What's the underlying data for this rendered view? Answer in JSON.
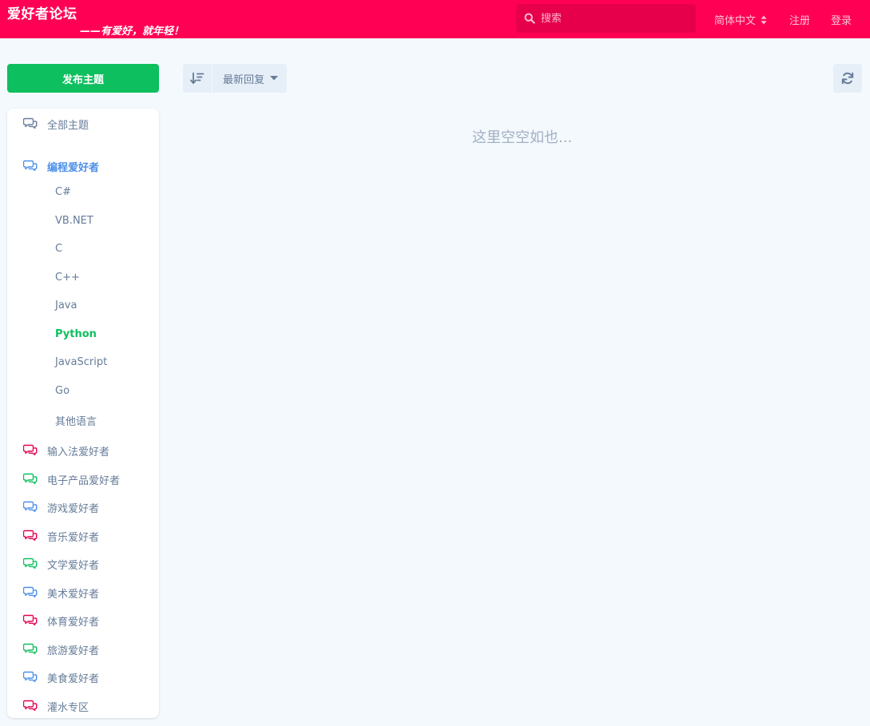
{
  "header": {
    "brand": "爱好者论坛",
    "slogan": "——有爱好，就年轻！",
    "search_placeholder": "搜索",
    "language": "简体中文",
    "register": "注册",
    "login": "登录"
  },
  "colors": {
    "brand_bar": "#ff0055",
    "primary_green": "#0dbf5e",
    "link_blue": "#4d8fe8",
    "muted_text": "#667c99"
  },
  "new_topic_label": "发布主题",
  "sidebar": {
    "all_topics": "全部主题",
    "programming": {
      "label": "编程爱好者",
      "children": [
        "C#",
        "VB.NET",
        "C",
        "C++",
        "Java",
        "Python",
        "JavaScript",
        "Go",
        "其他语言"
      ],
      "active_child": "Python"
    },
    "tags": [
      {
        "label": "输入法爱好者",
        "color": "#e6004c"
      },
      {
        "label": "电子产品爱好者",
        "color": "#0dbf5e"
      },
      {
        "label": "游戏爱好者",
        "color": "#4d8fe8"
      },
      {
        "label": "音乐爱好者",
        "color": "#e6004c"
      },
      {
        "label": "文学爱好者",
        "color": "#0dbf5e"
      },
      {
        "label": "美术爱好者",
        "color": "#4d8fe8"
      },
      {
        "label": "体育爱好者",
        "color": "#e6004c"
      },
      {
        "label": "旅游爱好者",
        "color": "#0dbf5e"
      },
      {
        "label": "美食爱好者",
        "color": "#4d8fe8"
      },
      {
        "label": "灌水专区",
        "color": "#e6004c"
      }
    ]
  },
  "toolbar": {
    "sort_label": "最新回复",
    "sort_icon": "sort-amount-down-icon",
    "refresh_icon": "refresh-icon"
  },
  "empty_message": "这里空空如也..."
}
